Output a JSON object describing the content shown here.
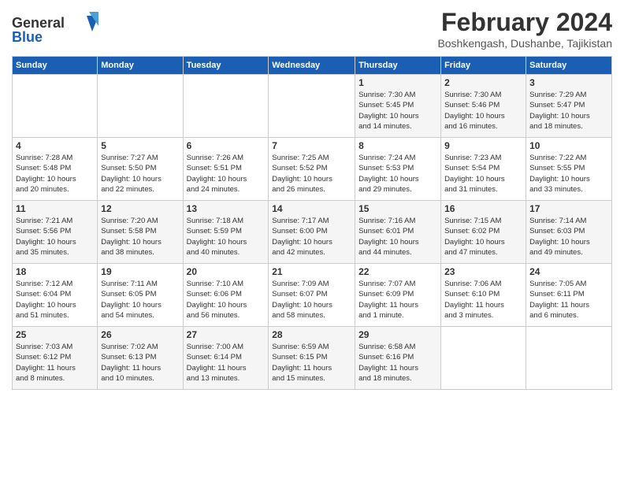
{
  "header": {
    "logo": {
      "general": "General",
      "blue": "Blue"
    },
    "title": "February 2024",
    "subtitle": "Boshkengash, Dushanbe, Tajikistan"
  },
  "weekdays": [
    "Sunday",
    "Monday",
    "Tuesday",
    "Wednesday",
    "Thursday",
    "Friday",
    "Saturday"
  ],
  "weeks": [
    [
      {
        "day": "",
        "info": ""
      },
      {
        "day": "",
        "info": ""
      },
      {
        "day": "",
        "info": ""
      },
      {
        "day": "",
        "info": ""
      },
      {
        "day": "1",
        "info": "Sunrise: 7:30 AM\nSunset: 5:45 PM\nDaylight: 10 hours\nand 14 minutes."
      },
      {
        "day": "2",
        "info": "Sunrise: 7:30 AM\nSunset: 5:46 PM\nDaylight: 10 hours\nand 16 minutes."
      },
      {
        "day": "3",
        "info": "Sunrise: 7:29 AM\nSunset: 5:47 PM\nDaylight: 10 hours\nand 18 minutes."
      }
    ],
    [
      {
        "day": "4",
        "info": "Sunrise: 7:28 AM\nSunset: 5:48 PM\nDaylight: 10 hours\nand 20 minutes."
      },
      {
        "day": "5",
        "info": "Sunrise: 7:27 AM\nSunset: 5:50 PM\nDaylight: 10 hours\nand 22 minutes."
      },
      {
        "day": "6",
        "info": "Sunrise: 7:26 AM\nSunset: 5:51 PM\nDaylight: 10 hours\nand 24 minutes."
      },
      {
        "day": "7",
        "info": "Sunrise: 7:25 AM\nSunset: 5:52 PM\nDaylight: 10 hours\nand 26 minutes."
      },
      {
        "day": "8",
        "info": "Sunrise: 7:24 AM\nSunset: 5:53 PM\nDaylight: 10 hours\nand 29 minutes."
      },
      {
        "day": "9",
        "info": "Sunrise: 7:23 AM\nSunset: 5:54 PM\nDaylight: 10 hours\nand 31 minutes."
      },
      {
        "day": "10",
        "info": "Sunrise: 7:22 AM\nSunset: 5:55 PM\nDaylight: 10 hours\nand 33 minutes."
      }
    ],
    [
      {
        "day": "11",
        "info": "Sunrise: 7:21 AM\nSunset: 5:56 PM\nDaylight: 10 hours\nand 35 minutes."
      },
      {
        "day": "12",
        "info": "Sunrise: 7:20 AM\nSunset: 5:58 PM\nDaylight: 10 hours\nand 38 minutes."
      },
      {
        "day": "13",
        "info": "Sunrise: 7:18 AM\nSunset: 5:59 PM\nDaylight: 10 hours\nand 40 minutes."
      },
      {
        "day": "14",
        "info": "Sunrise: 7:17 AM\nSunset: 6:00 PM\nDaylight: 10 hours\nand 42 minutes."
      },
      {
        "day": "15",
        "info": "Sunrise: 7:16 AM\nSunset: 6:01 PM\nDaylight: 10 hours\nand 44 minutes."
      },
      {
        "day": "16",
        "info": "Sunrise: 7:15 AM\nSunset: 6:02 PM\nDaylight: 10 hours\nand 47 minutes."
      },
      {
        "day": "17",
        "info": "Sunrise: 7:14 AM\nSunset: 6:03 PM\nDaylight: 10 hours\nand 49 minutes."
      }
    ],
    [
      {
        "day": "18",
        "info": "Sunrise: 7:12 AM\nSunset: 6:04 PM\nDaylight: 10 hours\nand 51 minutes."
      },
      {
        "day": "19",
        "info": "Sunrise: 7:11 AM\nSunset: 6:05 PM\nDaylight: 10 hours\nand 54 minutes."
      },
      {
        "day": "20",
        "info": "Sunrise: 7:10 AM\nSunset: 6:06 PM\nDaylight: 10 hours\nand 56 minutes."
      },
      {
        "day": "21",
        "info": "Sunrise: 7:09 AM\nSunset: 6:07 PM\nDaylight: 10 hours\nand 58 minutes."
      },
      {
        "day": "22",
        "info": "Sunrise: 7:07 AM\nSunset: 6:09 PM\nDaylight: 11 hours\nand 1 minute."
      },
      {
        "day": "23",
        "info": "Sunrise: 7:06 AM\nSunset: 6:10 PM\nDaylight: 11 hours\nand 3 minutes."
      },
      {
        "day": "24",
        "info": "Sunrise: 7:05 AM\nSunset: 6:11 PM\nDaylight: 11 hours\nand 6 minutes."
      }
    ],
    [
      {
        "day": "25",
        "info": "Sunrise: 7:03 AM\nSunset: 6:12 PM\nDaylight: 11 hours\nand 8 minutes."
      },
      {
        "day": "26",
        "info": "Sunrise: 7:02 AM\nSunset: 6:13 PM\nDaylight: 11 hours\nand 10 minutes."
      },
      {
        "day": "27",
        "info": "Sunrise: 7:00 AM\nSunset: 6:14 PM\nDaylight: 11 hours\nand 13 minutes."
      },
      {
        "day": "28",
        "info": "Sunrise: 6:59 AM\nSunset: 6:15 PM\nDaylight: 11 hours\nand 15 minutes."
      },
      {
        "day": "29",
        "info": "Sunrise: 6:58 AM\nSunset: 6:16 PM\nDaylight: 11 hours\nand 18 minutes."
      },
      {
        "day": "",
        "info": ""
      },
      {
        "day": "",
        "info": ""
      }
    ]
  ]
}
